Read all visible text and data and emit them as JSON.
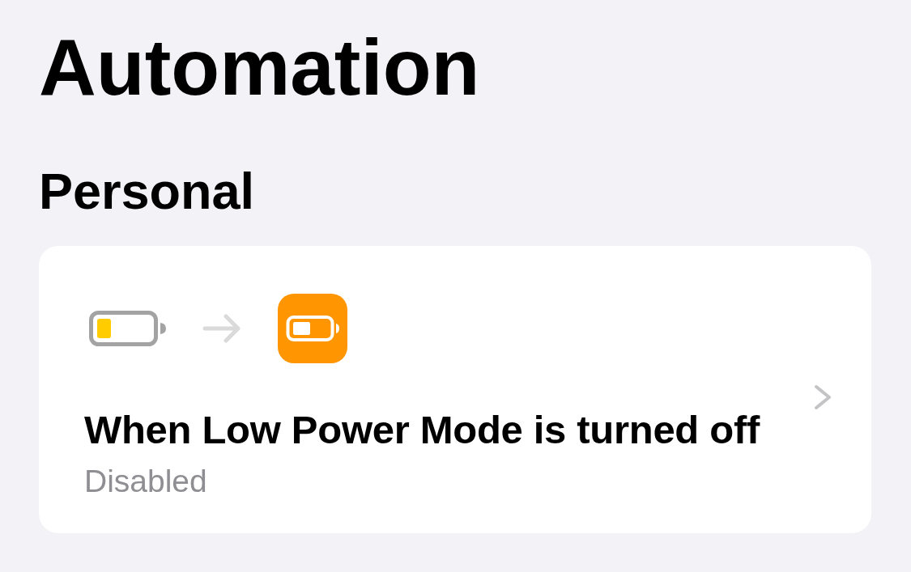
{
  "title": "Automation",
  "sections": [
    {
      "heading": "Personal",
      "automations": [
        {
          "title": "When Low Power Mode is turned off",
          "status": "Disabled"
        }
      ]
    }
  ]
}
